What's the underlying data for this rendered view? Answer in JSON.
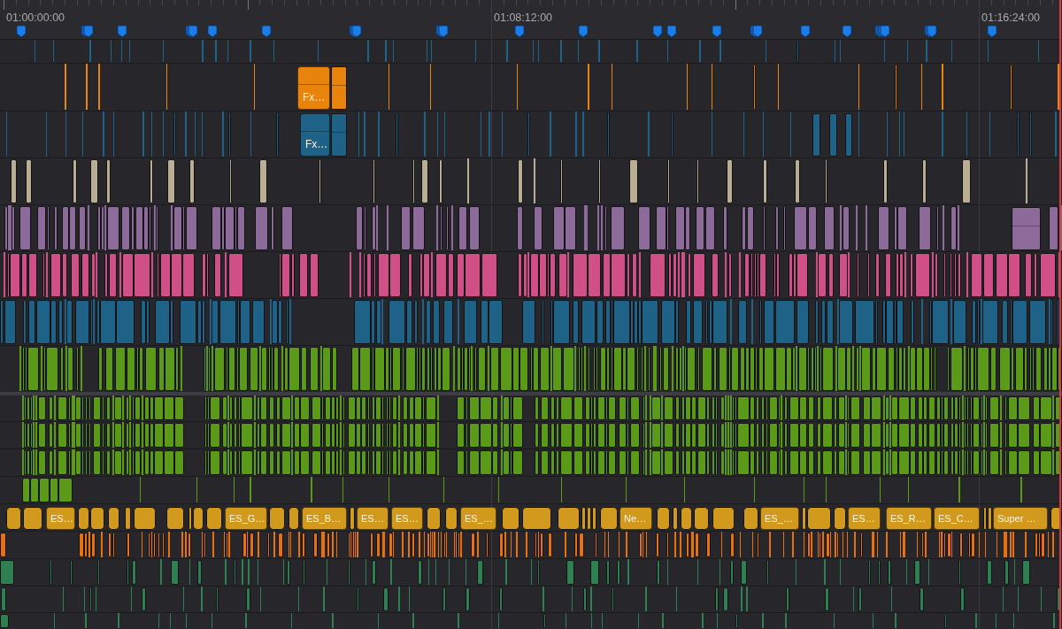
{
  "ruler": {
    "timecodes": [
      "01:00:00:00",
      "01:08:12:00",
      "01:16:24:00"
    ]
  },
  "tracks": [
    {
      "color": "#1f6288"
    },
    {
      "color": "#e8840c",
      "clip_labels": [
        "Fx…"
      ]
    },
    {
      "color": "#1f6288",
      "clip_labels": [
        "Fx…"
      ]
    },
    {
      "color": "#b9ae93"
    },
    {
      "color": "#8c6a9a"
    },
    {
      "color": "#cf4f86"
    },
    {
      "color": "#1f6288"
    },
    {
      "color": "#5a9a18"
    },
    {
      "color": "#5a9a18"
    },
    {
      "color": "#5a9a18"
    },
    {
      "color": "#5a9a18"
    },
    {
      "color": "#5a9a18"
    },
    {
      "color": "#d29a1c",
      "clip_labels": [
        "ES…",
        "ES_G…",
        "ES_B…",
        "ES…",
        "ES…",
        "ES_…",
        "Ne…",
        "ES_…",
        "ES…",
        "ES_R…",
        "ES_C…",
        "Super …"
      ]
    },
    {
      "color": "#e8700e"
    },
    {
      "color": "#2e7f52"
    },
    {
      "color": "#2e7f52"
    },
    {
      "color": "#2e7f52"
    }
  ]
}
